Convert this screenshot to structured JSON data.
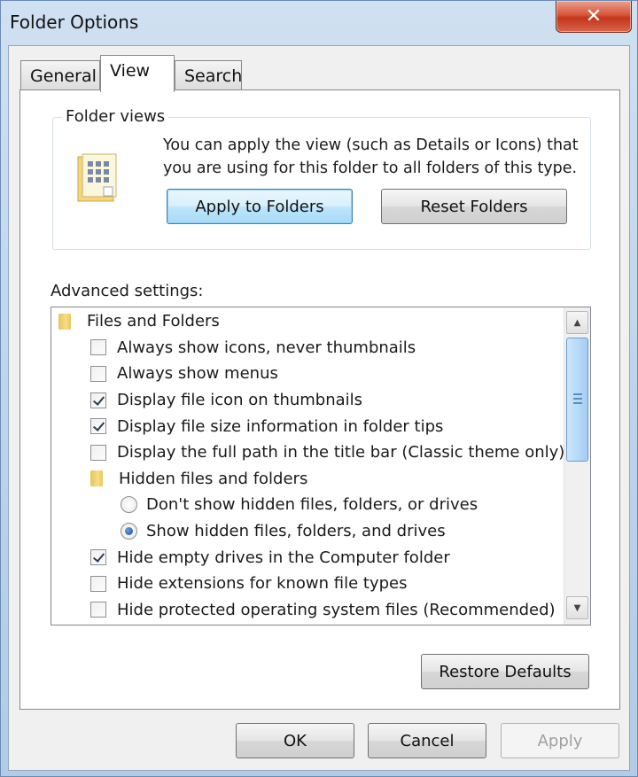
{
  "window": {
    "title": "Folder Options",
    "close_glyph": "✕"
  },
  "tabs": [
    {
      "label": "General"
    },
    {
      "label": "View"
    },
    {
      "label": "Search"
    }
  ],
  "folder_views": {
    "group_label": "Folder views",
    "description": "You can apply the view (such as Details or Icons) that you are using for this folder to all folders of this type.",
    "apply_button": "Apply to Folders",
    "reset_button": "Reset Folders"
  },
  "advanced": {
    "label": "Advanced settings:",
    "items": [
      {
        "kind": "folder",
        "indent": 0,
        "label": "Files and Folders"
      },
      {
        "kind": "checkbox",
        "indent": 1,
        "checked": false,
        "label": "Always show icons, never thumbnails"
      },
      {
        "kind": "checkbox",
        "indent": 1,
        "checked": false,
        "label": "Always show menus"
      },
      {
        "kind": "checkbox",
        "indent": 1,
        "checked": true,
        "label": "Display file icon on thumbnails"
      },
      {
        "kind": "checkbox",
        "indent": 1,
        "checked": true,
        "label": "Display file size information in folder tips"
      },
      {
        "kind": "checkbox",
        "indent": 1,
        "checked": false,
        "label": "Display the full path in the title bar (Classic theme only)"
      },
      {
        "kind": "folder",
        "indent": 1,
        "label": "Hidden files and folders"
      },
      {
        "kind": "radio",
        "indent": 2,
        "checked": false,
        "label": "Don't show hidden files, folders, or drives"
      },
      {
        "kind": "radio",
        "indent": 2,
        "checked": true,
        "label": "Show hidden files, folders, and drives"
      },
      {
        "kind": "checkbox",
        "indent": 1,
        "checked": true,
        "label": "Hide empty drives in the Computer folder"
      },
      {
        "kind": "checkbox",
        "indent": 1,
        "checked": false,
        "label": "Hide extensions for known file types"
      },
      {
        "kind": "checkbox",
        "indent": 1,
        "checked": false,
        "label": "Hide protected operating system files (Recommended)"
      }
    ]
  },
  "restore_defaults": "Restore Defaults",
  "dialog_buttons": {
    "ok": "OK",
    "cancel": "Cancel",
    "apply": "Apply"
  }
}
